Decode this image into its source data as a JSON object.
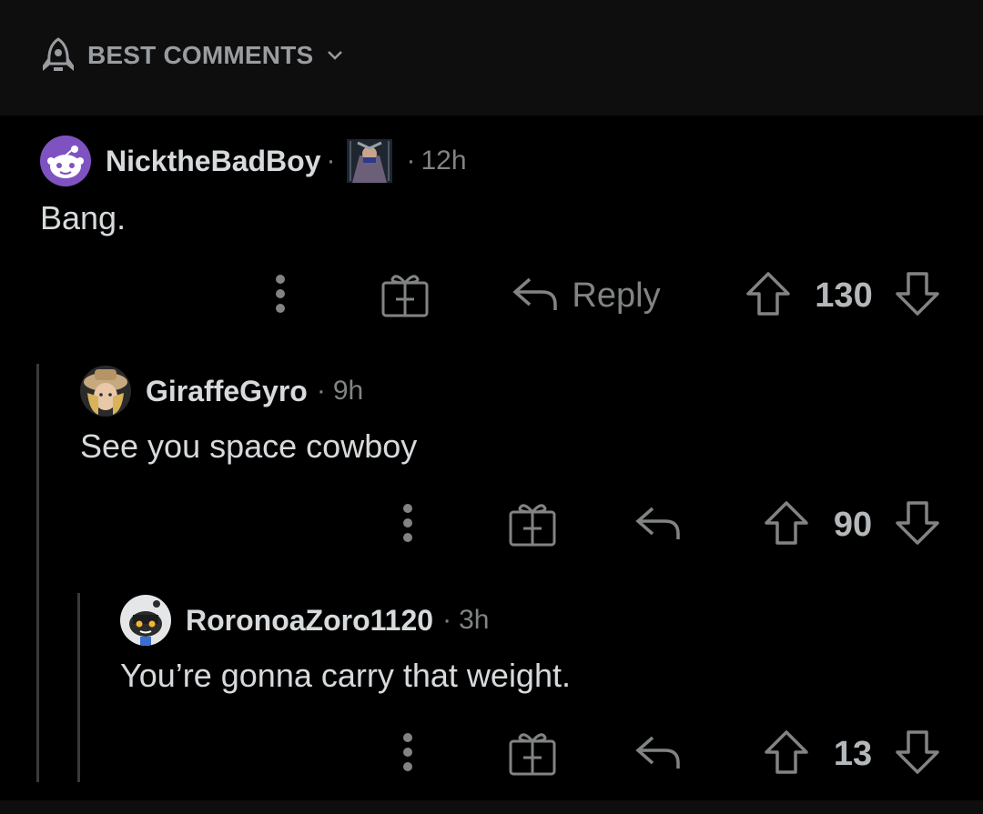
{
  "sort": {
    "label": "BEST COMMENTS"
  },
  "comments": [
    {
      "username": "NicktheBadBoy",
      "separator": "·",
      "time": "12h",
      "body": "Bang.",
      "score": "130",
      "reply_label": "Reply"
    },
    {
      "username": "GiraffeGyro",
      "separator": "·",
      "time": "9h",
      "body": "See you space cowboy",
      "score": "90"
    },
    {
      "username": "RoronoaZoro1120",
      "separator": "·",
      "time": "3h",
      "body": "You’re gonna carry that weight.",
      "score": "13"
    }
  ],
  "colors": {
    "background": "#000000",
    "header": "#0e0e0f",
    "text": "#d7dadc",
    "muted": "#818384",
    "thread_line": "#3a3a3c"
  }
}
